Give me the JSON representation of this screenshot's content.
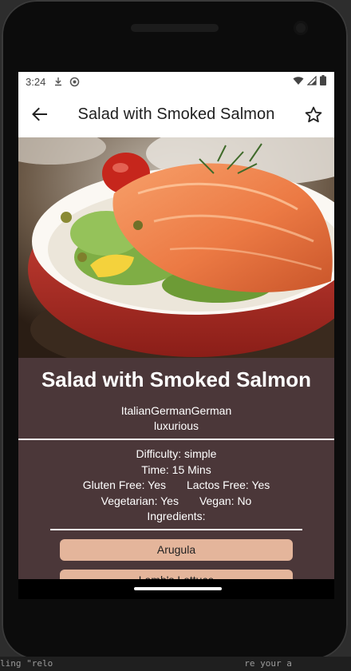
{
  "ide_backdrop": {
    "snippet_left": "ling \"relo",
    "snippet_right": "re your a"
  },
  "status_bar": {
    "time": "3:24",
    "icons": [
      "download-icon",
      "sync-icon",
      "wifi-icon",
      "signal-icon",
      "battery-icon"
    ]
  },
  "app_bar": {
    "back_icon": "arrow-back-icon",
    "title": "Salad with Smoked Salmon",
    "favorite_icon": "star-outline-icon"
  },
  "hero": {
    "image_subject": "Smoked salmon salad in a red bowl"
  },
  "recipe": {
    "title": "Salad with Smoked Salmon",
    "cuisines": "ItalianGermanGerman",
    "affordability": "luxurious",
    "difficulty": "Difficulty: simple",
    "time": "Time: 15 Mins",
    "gluten_free": "Gluten Free: Yes",
    "lactose_free": "Lactos Free: Yes",
    "vegetarian": "Vegetarian: Yes",
    "vegan": "Vegan: No",
    "ingredients_heading": "Ingredients:",
    "ingredients": [
      "Arugula",
      "Lamb's Lettuce"
    ]
  },
  "colors": {
    "details_background": "#4b3739",
    "ingredient_chip": "#e4b59b",
    "text_on_details": "#ffffff"
  }
}
